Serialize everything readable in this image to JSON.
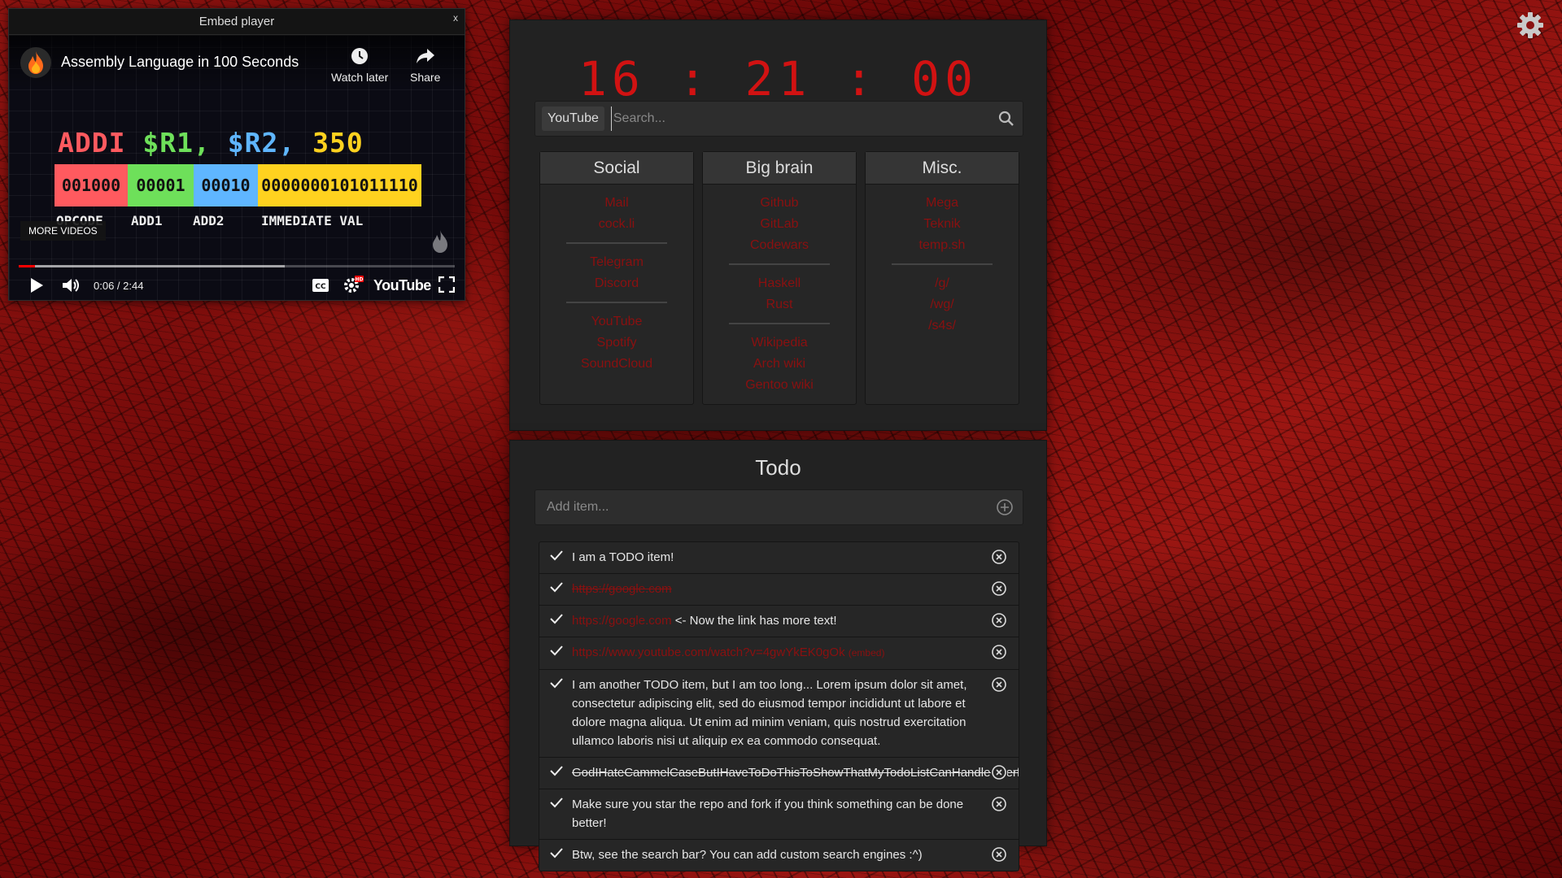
{
  "embed": {
    "window_title": "Embed player",
    "close_label": "x",
    "video_title": "Assembly Language in 100 Seconds",
    "watch_later_label": "Watch later",
    "share_label": "Share",
    "asm_parts": [
      "ADDI",
      "$R1,",
      "$R2,",
      "350"
    ],
    "asm_boxes": [
      "001000",
      "00001",
      "00010",
      "0000000101011110"
    ],
    "asm_captions": [
      "OPCODE",
      "ADD1",
      "ADD2",
      "IMMEDIATE VAL"
    ],
    "more_videos_label": "MORE VIDEOS",
    "time_display": "0:06 / 2:44",
    "progress_played": 0.037,
    "progress_buffered": 0.61,
    "youtube_wordmark": "YouTube",
    "colors": {
      "opcode": "#ff5a5f",
      "add1": "#6ee05a",
      "add2": "#5fb6ff",
      "imm": "#ffd21f",
      "progress": "#ff0000"
    }
  },
  "clock": {
    "time": "16 : 21 : 00",
    "color": "#d11212"
  },
  "search": {
    "engine": "YouTube",
    "placeholder": "Search..."
  },
  "link_columns": [
    {
      "title": "Social",
      "groups": [
        [
          "Mail",
          "cock.li"
        ],
        [
          "Telegram",
          "Discord"
        ],
        [
          "YouTube",
          "Spotify",
          "SoundCloud"
        ]
      ]
    },
    {
      "title": "Big brain",
      "groups": [
        [
          "Github",
          "GitLab",
          "Codewars"
        ],
        [
          "Haskell",
          "Rust"
        ],
        [
          "Wikipedia",
          "Arch wiki",
          "Gentoo wiki"
        ]
      ]
    },
    {
      "title": "Misc.",
      "groups": [
        [
          "Mega",
          "Teknik",
          "temp.sh"
        ],
        [
          "/g/",
          "/wg/",
          "/s4s/"
        ]
      ]
    }
  ],
  "todo": {
    "title": "Todo",
    "add_placeholder": "Add item...",
    "items": [
      {
        "text": "I am a TODO item!",
        "done": false
      },
      {
        "link": "https://google.com",
        "done": true
      },
      {
        "link": "https://google.com",
        "text": " <- Now the link has more text!",
        "done": false
      },
      {
        "link": "https://www.youtube.com/watch?v=4gwYkEK0gOk",
        "small": "(embed)",
        "done": false
      },
      {
        "text": "I am another TODO item, but I am too long... Lorem ipsum dolor sit amet, consectetur adipiscing elit, sed do eiusmod tempor incididunt ut labore et dolore magna aliqua. Ut enim ad minim veniam, quis nostrud exercitation ullamco laboris nisi ut aliquip ex ea commodo consequat.",
        "done": false
      },
      {
        "text": "GodIHateCammelCaseButIHaveToDoThisToShowThatMyTodoListCanHandleOverflow",
        "done": true
      },
      {
        "text": "Make sure you star the repo and fork if you think something can be done better!",
        "done": false
      },
      {
        "text": "Btw, see the search bar? You can add custom search engines :^)",
        "done": false
      }
    ]
  },
  "theme": {
    "accent": "#d11212",
    "link": "#8a1010",
    "panel": "#222222"
  },
  "icons": {
    "settings": "gear-icon",
    "search": "search-icon",
    "add": "plus-circle-icon",
    "check": "check-icon",
    "delete": "close-circle-icon"
  }
}
